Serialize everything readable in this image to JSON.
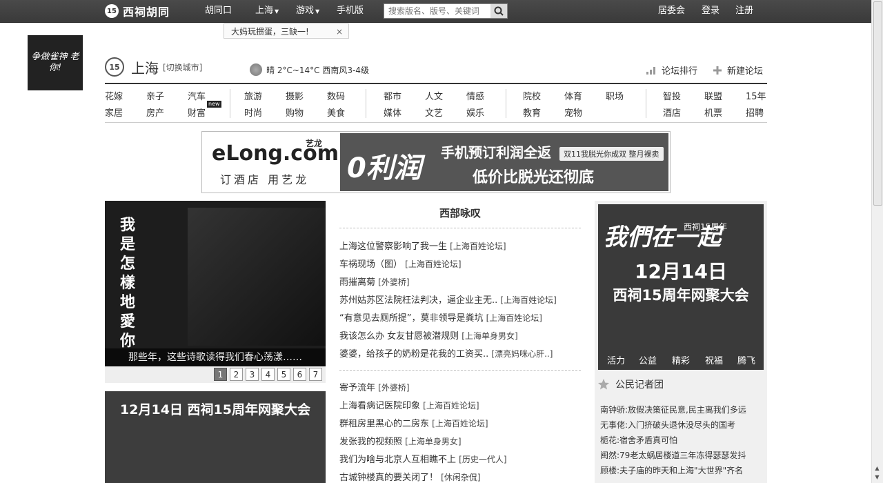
{
  "topbar": {
    "logo_num": "15",
    "logo_text": "西祠胡同",
    "nav": [
      "胡同口",
      "上海",
      "游戏",
      "手机版"
    ],
    "search_placeholder": "搜索版名、版号、关键词",
    "right": [
      "居委会",
      "登录",
      "注册"
    ]
  },
  "tip": {
    "text": "大妈玩掼蛋，三缺一!",
    "close": "×"
  },
  "side_logo": {
    "text": "争做雀神 老你!"
  },
  "city": {
    "num": "15",
    "name": "上海",
    "switch": "[切换城市]"
  },
  "weather": {
    "text": "晴 2°C~14°C 西南风3-4级"
  },
  "links": {
    "rank": "论坛排行",
    "new_forum": "新建论坛"
  },
  "categories": {
    "g1": [
      [
        "花嫁",
        "亲子",
        "汽车"
      ],
      [
        "家居",
        "房产",
        "财富"
      ]
    ],
    "g2": [
      [
        "旅游",
        "摄影",
        "数码"
      ],
      [
        "时尚",
        "购物",
        "美食"
      ]
    ],
    "g3": [
      [
        "都市",
        "人文",
        "情感"
      ],
      [
        "媒体",
        "文艺",
        "娱乐"
      ]
    ],
    "g4": [
      [
        "院校",
        "体育",
        "职场"
      ],
      [
        "教育",
        "宠物",
        ""
      ]
    ],
    "g5": [
      [
        "智投",
        "联盟",
        "15年"
      ],
      [
        "酒店",
        "机票",
        "招聘"
      ]
    ],
    "new_badge": "new"
  },
  "banner": {
    "brand": "eLong.com",
    "brand_cn": "艺龙",
    "sub": "订酒店 用艺龙",
    "big": "0利润",
    "line1": "手机预订利润全返",
    "line2": "低价比脱光还彻底",
    "tag": "双11我脱光你成双 整月裸卖"
  },
  "slideshow": {
    "vertical_text": "我是怎樣地愛你",
    "caption": "那些年，这些诗歌读得我们春心荡漾……",
    "pages": [
      "1",
      "2",
      "3",
      "4",
      "5",
      "6",
      "7"
    ],
    "active": 0
  },
  "poster2": {
    "title": "12月14日  西祠15周年网聚大会"
  },
  "middle": {
    "title": "西部咏叹",
    "group1": [
      {
        "t": "上海这位警察影响了我一生",
        "s": "[上海百姓论坛]"
      },
      {
        "t": "车祸现场（图）",
        "s": "[上海百姓论坛]"
      },
      {
        "t": "雨摧离菊",
        "s": "[外婆桥]"
      },
      {
        "t": "苏州姑苏区法院枉法判决，逼企业主无..",
        "s": "[上海百姓论坛]"
      },
      {
        "t": "“有意见去厕所提”，莫非领导是粪坑",
        "s": "[上海百姓论坛]"
      },
      {
        "t": "我该怎么办 女友甘愿被潜规则",
        "s": "[上海单身男女]"
      },
      {
        "t": "婆婆，给孩子的奶粉是花我的工资买..",
        "s": "[漂亮妈咪心肝..]"
      }
    ],
    "group2": [
      {
        "t": "寄予流年",
        "s": "[外婆桥]"
      },
      {
        "t": "上海看病记医院印象",
        "s": "[上海百姓论坛]"
      },
      {
        "t": "群租房里黑心的二房东",
        "s": "[上海百姓论坛]"
      },
      {
        "t": "发张我的视频照",
        "s": "[上海单身男女]"
      },
      {
        "t": "我们为啥与北京人互相瞧不上",
        "s": "[历史一代人]"
      },
      {
        "t": "古城钟楼真的要关闭了！",
        "s": "[休闲杂侃]"
      }
    ]
  },
  "right": {
    "poster": {
      "a": "我們在一起",
      "tag": "西祠15周年",
      "b": "12月14日",
      "c": "西祠15周年网聚大会",
      "d": [
        "活力",
        "公益",
        "精彩",
        "祝福",
        "腾飞"
      ]
    },
    "head": "公民记者团",
    "list": [
      "南钟骄:放假决策征民意,民主离我们多远",
      "无事佬:入门挤破头退休没尽头的国考",
      "栀花:宿舍矛盾真可怕",
      "闽然:79老太蜗居楼道三年冻得瑟瑟发抖",
      "顾楼:夫子庙的昨天和上海\"大世界\"齐名"
    ]
  }
}
